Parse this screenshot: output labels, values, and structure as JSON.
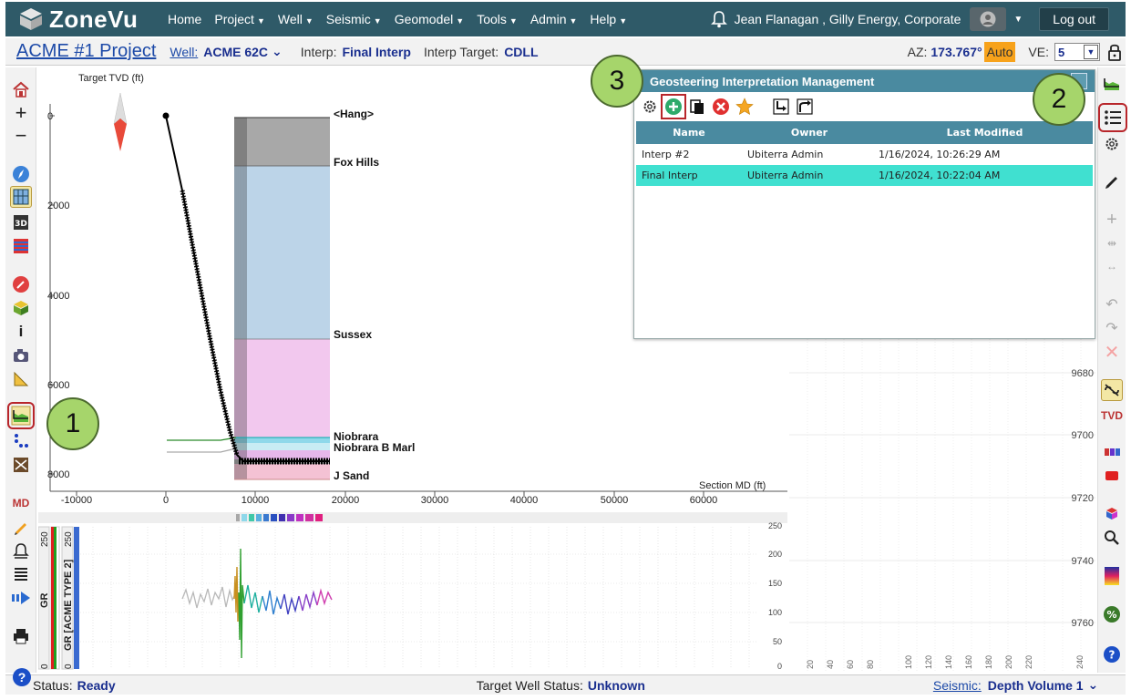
{
  "app": {
    "name": "ZoneVu"
  },
  "nav": {
    "items": [
      "Home",
      "Project",
      "Well",
      "Seismic",
      "Geomodel",
      "Tools",
      "Admin",
      "Help"
    ],
    "user": "Jean Flanagan , Gilly Energy, Corporate",
    "logout": "Log out"
  },
  "project": {
    "title": "ACME #1 Project",
    "well_label": "Well:",
    "well_value": "ACME 62C",
    "interp_label": "Interp:",
    "interp_value": "Final Interp",
    "target_label": "Interp Target:",
    "target_value": "CDLL",
    "az_label": "AZ:",
    "az_value": "173.767°",
    "auto_label": "Auto",
    "ve_label": "VE:",
    "ve_value": "5"
  },
  "plot": {
    "y_title": "Target TVD (ft)",
    "x_title": "Section MD (ft)",
    "y_ticks": [
      "0",
      "2000",
      "4000",
      "6000",
      "8000"
    ],
    "x_ticks": [
      "-10000",
      "0",
      "10000",
      "20000",
      "30000",
      "40000",
      "50000",
      "60000"
    ],
    "formations": [
      "<Hang>",
      "Fox Hills",
      "Sussex",
      "Niobrara",
      "Niobrara B Marl",
      "J Sand"
    ],
    "colors": {
      "hang": "#a8a8a8",
      "fox_hills": "#bcd4e8",
      "sussex": "#f2c8ee",
      "niobrara": "#8fd8ea",
      "jsand": "#f4c2d4"
    }
  },
  "tracks": {
    "gr_label": "GR",
    "gr_type_label": "GR [ACME TYPE 2]",
    "gr_min": "0",
    "gr_max": "250",
    "scale_ticks": [
      "250",
      "200",
      "150",
      "100",
      "50",
      "0"
    ]
  },
  "right_panel": {
    "depth_ticks": [
      "9680",
      "9700",
      "9720",
      "9740",
      "9760"
    ],
    "bottom_ticks": [
      "20",
      "40",
      "60",
      "80",
      "100",
      "120",
      "140",
      "160",
      "180",
      "200",
      "220",
      "240"
    ]
  },
  "popup": {
    "title": "Geosteering Interpretation Management",
    "columns": [
      "Name",
      "Owner",
      "Last Modified"
    ],
    "rows": [
      {
        "name": "Interp #2",
        "owner": "Ubiterra Admin",
        "modified": "1/16/2024, 10:26:29 AM"
      },
      {
        "name": "Final Interp",
        "owner": "Ubiterra Admin",
        "modified": "1/16/2024, 10:22:04 AM"
      }
    ]
  },
  "callouts": [
    "1",
    "2",
    "3"
  ],
  "status": {
    "label": "Status:",
    "value": "Ready",
    "target_label": "Target Well Status:",
    "target_value": "Unknown",
    "seismic_label": "Seismic:",
    "seismic_value": "Depth Volume 1"
  },
  "right_tb_text": {
    "tvd": "TVD"
  },
  "left_tb_text": {
    "md": "MD",
    "info": "i"
  }
}
